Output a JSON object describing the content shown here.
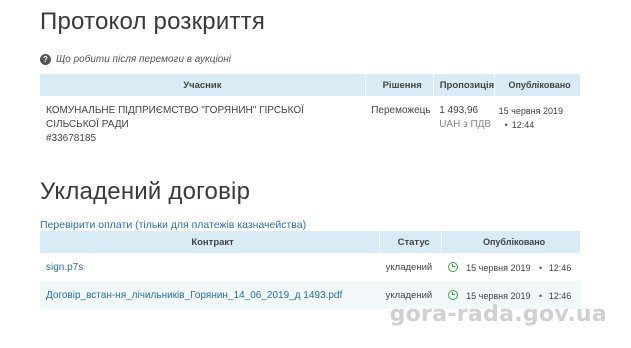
{
  "disclosure": {
    "title": "Протокол розкриття",
    "help_text": "Що робити після перемоги в аукціоні",
    "columns": [
      "Учасник",
      "Рішення",
      "Пропозиція",
      "Опубліковано"
    ],
    "row": {
      "participant_name": "КОМУНАЛЬНЕ ПІДПРИЄМСТВО \"ГОРЯНИН\" ГІРСЬКОЇ СІЛЬСЬКОЇ РАДИ",
      "participant_code": "#33678185",
      "decision": "Переможець",
      "amount": "1 493,96",
      "currency": "UAH з ПДВ",
      "date": "15 червня 2019",
      "time": "12:44"
    }
  },
  "contract": {
    "title": "Укладений договір",
    "check_link": "Перевірити оплати (тільки для платежів казначейства)",
    "columns": [
      "Контракт",
      "Статус",
      "Опубліковано"
    ],
    "rows": [
      {
        "file": "sign.p7s",
        "status": "укладений",
        "date": "15 червня 2019",
        "time": "12:46"
      },
      {
        "file": "Договір_встан-ня_лічильників_Горянин_14_06_2019_д 1493.pdf",
        "status": "укладений",
        "date": "15 червня 2019",
        "time": "12:46"
      }
    ]
  },
  "watermark": "gora-rada.gov.ua",
  "colors": {
    "header_bg": "#d9ecf5",
    "link": "#2a6fb0",
    "clock": "#3aa84a"
  }
}
